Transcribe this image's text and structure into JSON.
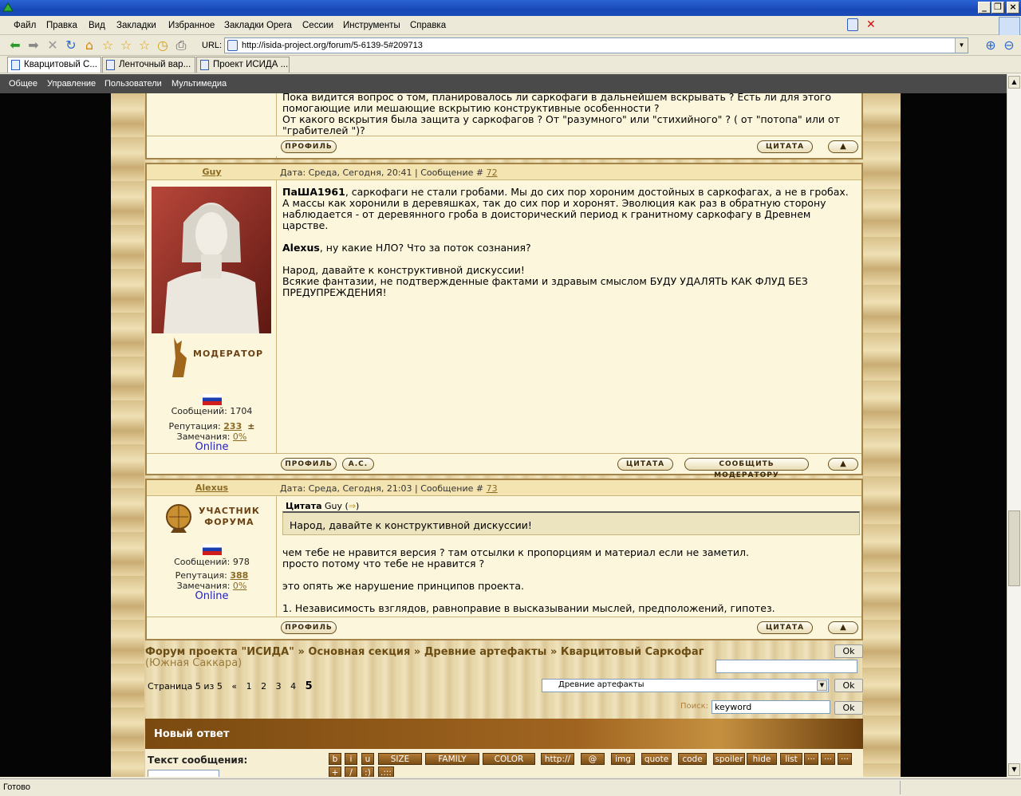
{
  "menu": [
    "Файл",
    "Правка",
    "Вид",
    "Закладки",
    "Избранное",
    "Закладки Opera",
    "Сессии",
    "Инструменты",
    "Справка"
  ],
  "url": {
    "label": "URL:",
    "value": "http://isida-project.org/forum/5-6139-5#209713"
  },
  "tabs": [
    "Кварцитовый С...",
    "Ленточный вар...",
    "Проект ИСИДА ..."
  ],
  "panel": [
    "Общее",
    "Управление",
    "Пользователи",
    "Мультимедиа"
  ],
  "top_post": {
    "text": [
      "Пока видится вопрос о том, планировалось ли саркофаги в дальнейшем вскрывать ? Есть ли для этого",
      "помогающие или мешающие вскрытию конструктивные особенности ?",
      "От какого вскрытия была защита у саркофагов ? От \"разумного\" или \"стихийного\" ? ( от \"потопа\" или от",
      "\"грабителей \")?"
    ]
  },
  "buttons": {
    "profile": "ПРОФИЛЬ",
    "quote": "ЦИТАТА",
    "as": "А.С.",
    "report": "СООБЩИТЬ МОДЕРАТОРУ",
    "up": "▲"
  },
  "post72": {
    "nick": "Guy",
    "meta_prefix": "Дата: Среда, Сегодня, 20:41 | Сообщение #",
    "num": "72",
    "rank": "МОДЕРАТОР",
    "messages": "Сообщений: 1704",
    "rep_label": "Репутация:",
    "rep": "233",
    "rep_pm": "±",
    "warn_label": "Замечания:",
    "warn": "0%",
    "online": "Online",
    "p1_bold": "ПаША1961",
    "p1": ", саркофаги не стали гробами. Мы до сих пор хороним достойных в саркофагах, а не в гробах. А массы как хоронили в деревяшках, так до сих пор и хоронят. Эволюция как раз в обратную сторону наблюдается - от деревянного гроба в доисторический период к гранитному саркофагу в Древнем царстве.",
    "p2_bold": "Alexus",
    "p2": ", ну какие НЛО? Что за поток сознания?",
    "p3": "Народ, давайте к конструктивной дискуссии!",
    "p4": "Всякие фантазии, не подтвержденные фактами и здравым смыслом БУДУ УДАЛЯТЬ КАК ФЛУД БЕЗ ПРЕДУПРЕЖДЕНИЯ!"
  },
  "post73": {
    "nick": "Alexus",
    "meta_prefix": "Дата: Среда, Сегодня, 21:03 | Сообщение #",
    "num": "73",
    "rank_line1": "УЧАСТНИК",
    "rank_line2": "ФОРУМА",
    "messages": "Сообщений: 978",
    "rep_label": "Репутация:",
    "rep": "388",
    "warn_label": "Замечания:",
    "warn": "0%",
    "online": "Online",
    "quote_label": "Цитата",
    "quote_author": "Guy",
    "quote_text": "Народ, давайте к конструктивной дискуссии!",
    "l1": "чем тебе не нравится версия ? там отсылки к пропорциям и материал если не заметил.",
    "l2": "просто потому что тебе не нравится ?",
    "l3": "это опять же нарушение принципов проекта.",
    "l4": "1. Независимость взглядов, равноправие в высказывании мыслей, предположений, гипотез."
  },
  "crumbs": {
    "a": "Форум проекта \"ИСИДА\"",
    "sep": "»",
    "b": "Основная секция",
    "c": "Древние артефакты",
    "d": "Кварцитовый Саркофаг",
    "sub": "(Южная Саккара)"
  },
  "pager": {
    "label": "Страница 5 из 5",
    "prev": "«",
    "pages": [
      "1",
      "2",
      "3",
      "4"
    ],
    "current": "5"
  },
  "forum_select": "Древние артефакты",
  "ok": "Ok",
  "search": {
    "label": "Поиск:",
    "value": "keyword"
  },
  "reply": {
    "title": "Новый ответ",
    "text_label": "Текст сообщения:"
  },
  "toolbar_tags": [
    "b",
    "i",
    "u",
    "SIZE",
    "FAMILY",
    "COLOR",
    "http://",
    "@",
    "img",
    "quote",
    "code",
    "spoiler",
    "hide",
    "list",
    "···",
    "···",
    "···",
    "+",
    "/",
    ":)",
    ".:::"
  ],
  "status": "Готово"
}
